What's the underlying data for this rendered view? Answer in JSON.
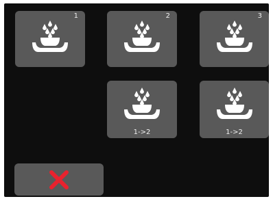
{
  "colors": {
    "background": "#0e0e0e",
    "tile": "#595959",
    "icon": "#ffffff",
    "cancel": "#e8222e"
  },
  "tiles": [
    {
      "icon": "steam-bowl-icon",
      "corner_label": "1",
      "sub_label": ""
    },
    {
      "icon": "steam-bowl-icon",
      "corner_label": "2",
      "sub_label": ""
    },
    {
      "icon": "steam-bowl-icon",
      "corner_label": "3",
      "sub_label": ""
    },
    {
      "icon": "steam-bowl-icon",
      "corner_label": "",
      "sub_label": "1->2"
    },
    {
      "icon": "steam-bowl-icon",
      "corner_label": "",
      "sub_label": "1->2"
    }
  ],
  "cancel_button": {
    "icon": "close-icon"
  }
}
